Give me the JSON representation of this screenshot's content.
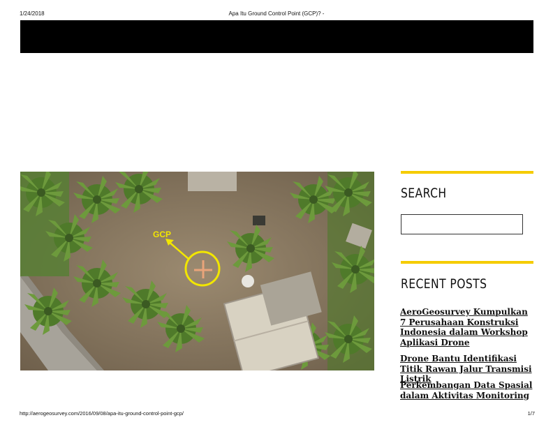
{
  "print_header": {
    "date": "1/24/2018",
    "title": "Apa Itu Ground Control Point (GCP)? -"
  },
  "featured_image": {
    "annotation_label": "GCP",
    "annotation_color": "#f2e600",
    "marker_color": "#e9a47a"
  },
  "sidebar": {
    "search_title": "SEARCH",
    "search_placeholder": "",
    "recent_title": "RECENT POSTS",
    "accent_color": "#f5cc00",
    "recent_posts": [
      "AeroGeosurvey Kumpulkan 7 Perusahaan Konstruksi Indonesia dalam Workshop Aplikasi Drone",
      "Drone Bantu Identifikasi Titik Rawan Jalur Transmisi Listrik",
      "Perkembangan Data Spasial dalam Aktivitas Monitoring"
    ]
  },
  "print_footer": {
    "url": "http://aerogeosurvey.com/2016/09/08/apa-itu-ground-control-point-gcp/",
    "page": "1/7"
  }
}
